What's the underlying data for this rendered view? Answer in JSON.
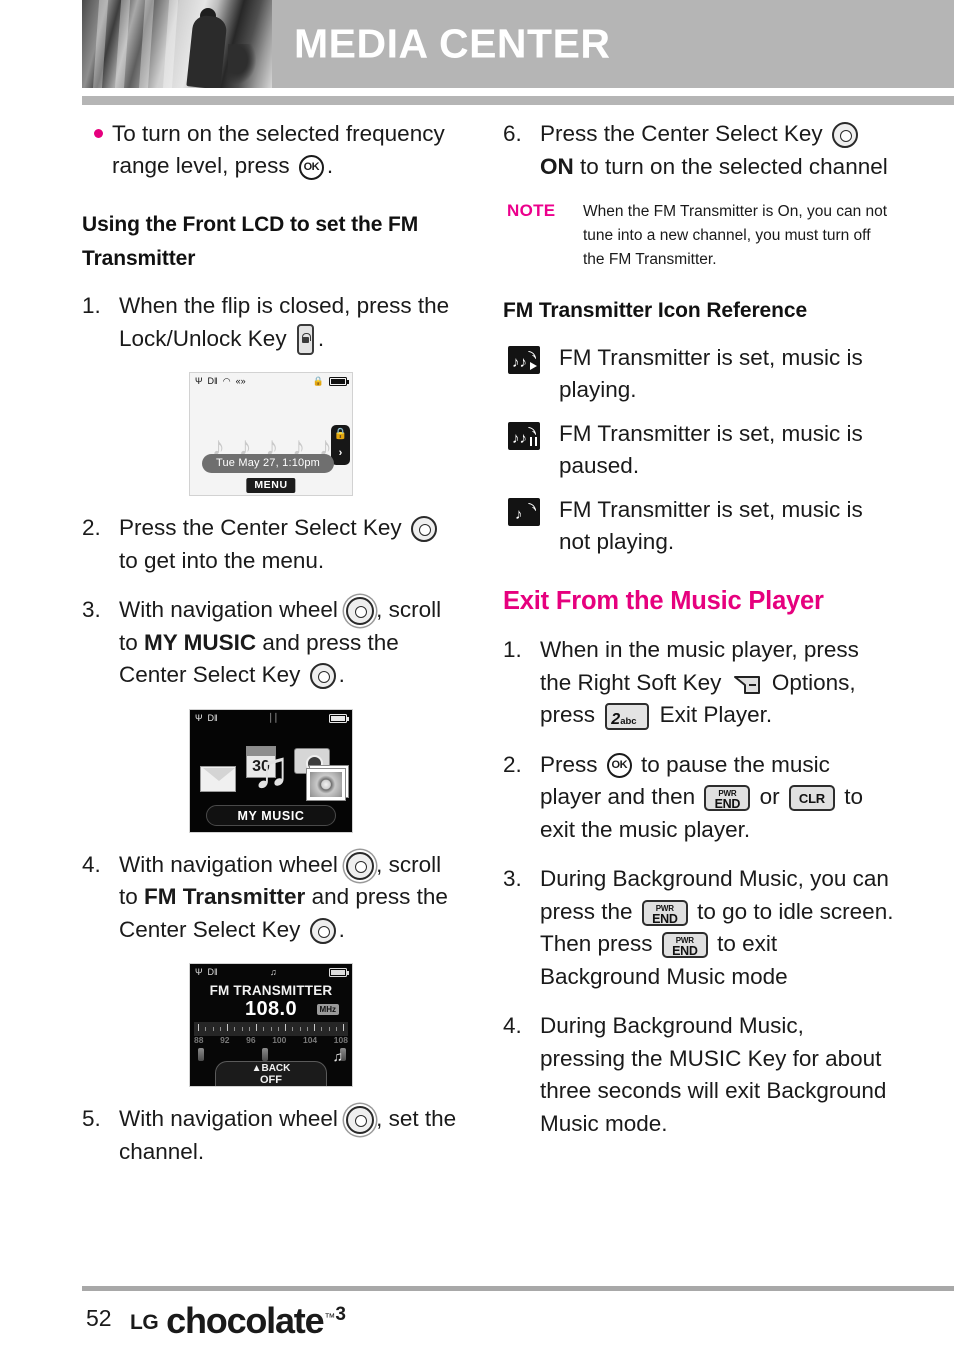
{
  "header": {
    "title": "MEDIA CENTER",
    "photo_alt": "grayscale-photo"
  },
  "left_column": {
    "bullet": {
      "text_before": "To turn on the selected frequency range level, press",
      "key": "OK",
      "text_after": "."
    },
    "section_heading": "Using the Front LCD to set the FM Transmitter",
    "steps": [
      {
        "num": "1.",
        "text_before": "When the flip is closed, press the Lock/Unlock Key",
        "key": "lock-unlock",
        "text_after": "."
      },
      {
        "num": "2.",
        "text_before": "Press the Center Select Key",
        "key": "center-select",
        "text_after": "to get into the menu."
      },
      {
        "num": "3.",
        "text_before": "With navigation wheel",
        "key": "navigation-wheel",
        "text_mid": ", scroll to",
        "bold": "MY MUSIC",
        "text_mid2": "and press the Center Select Key",
        "key2": "center-select",
        "text_after": "."
      },
      {
        "num": "4.",
        "text_before": "With navigation wheel",
        "key": "navigation-wheel",
        "text_mid": ", scroll to",
        "bold": "FM Transmitter",
        "text_mid2": "and press the Center Select Key",
        "key2": "center-select",
        "text_after": "."
      },
      {
        "num": "5.",
        "text_before": "With navigation wheel",
        "key": "navigation-wheel",
        "text_after": ", set the channel."
      }
    ],
    "screens": {
      "idle": {
        "clock": "Tue May 27, 1:10pm",
        "softkey": "MENU",
        "lock_icon": "lock-icon",
        "arrow": "›",
        "status_icons": [
          "signal-icon",
          "digital-icon",
          "roaming-icon",
          "vibrate-icon",
          "lock-icon",
          "battery-icon"
        ]
      },
      "my_music": {
        "label": "MY MUSIC",
        "calendar_day": "30",
        "tiles": [
          "message-icon",
          "calendar-icon",
          "camera-icon",
          "music-note-icon",
          "pictures-icon"
        ],
        "status_icons": [
          "signal-icon",
          "digital-icon",
          "vibrate-icon",
          "battery-icon"
        ]
      },
      "fm_transmitter": {
        "title": "FM TRANSMITTER",
        "frequency": "108.0",
        "unit": "MHz",
        "scale_labels": [
          "88",
          "92",
          "96",
          "100",
          "104",
          "108"
        ],
        "soft_back": "▲BACK",
        "soft_off": "OFF",
        "status_icons": [
          "signal-icon",
          "digital-icon",
          "music-note-icon",
          "battery-icon"
        ]
      }
    }
  },
  "right_column": {
    "step6": {
      "num": "6.",
      "text_before": "Press the Center Select Key",
      "key": "center-select",
      "bold": "ON",
      "text_after": "to turn on the selected channel"
    },
    "note": {
      "label": "NOTE",
      "body": "When the FM Transmitter is On, you can not tune into a new channel, you must turn off the FM Transmitter."
    },
    "icon_reference": {
      "heading": "FM Transmitter Icon Reference",
      "items": [
        {
          "icon": "fm-music-playing-icon",
          "state": "play",
          "text": "FM Transmitter is set, music is playing."
        },
        {
          "icon": "fm-music-paused-icon",
          "state": "pause",
          "text": "FM Transmitter is set, music is paused."
        },
        {
          "icon": "fm-music-stopped-icon",
          "state": "none",
          "text": "FM Transmitter is set, music is not playing."
        }
      ]
    },
    "exit_section": {
      "heading": "Exit From the Music Player",
      "steps": [
        {
          "num": "1.",
          "text_before": "When in the music player, press the Right Soft Key",
          "key": "right-soft-key",
          "text_mid": "Options, press",
          "key2_digit": "2",
          "key2_letters": "abc",
          "text_after": "Exit Player."
        },
        {
          "num": "2.",
          "text_before": "Press",
          "key": "OK",
          "text_mid": "to pause the music player and then",
          "key2_l1": "PWR",
          "key2_l2": "END",
          "text_mid2": "or",
          "key3": "CLR",
          "text_after": "to exit the music player."
        },
        {
          "num": "3.",
          "text_before": "During Background Music, you can press the",
          "key_l1": "PWR",
          "key_l2": "END",
          "text_mid": "to go to idle screen. Then press",
          "key2_l1": "PWR",
          "key2_l2": "END",
          "text_after": "to exit Background Music mode"
        },
        {
          "num": "4.",
          "text_full": "During Background Music, pressing the MUSIC Key for about three seconds will exit Background Music mode."
        }
      ]
    }
  },
  "footer": {
    "page_number": "52",
    "brand_lg": "LG",
    "brand_name": "chocolate",
    "brand_tm": "™",
    "brand_version": "3"
  },
  "colors": {
    "accent_pink": "#e6007e",
    "note_pink": "#ec008c",
    "header_gray": "#b5b5b5",
    "text": "#1a1a1a"
  }
}
